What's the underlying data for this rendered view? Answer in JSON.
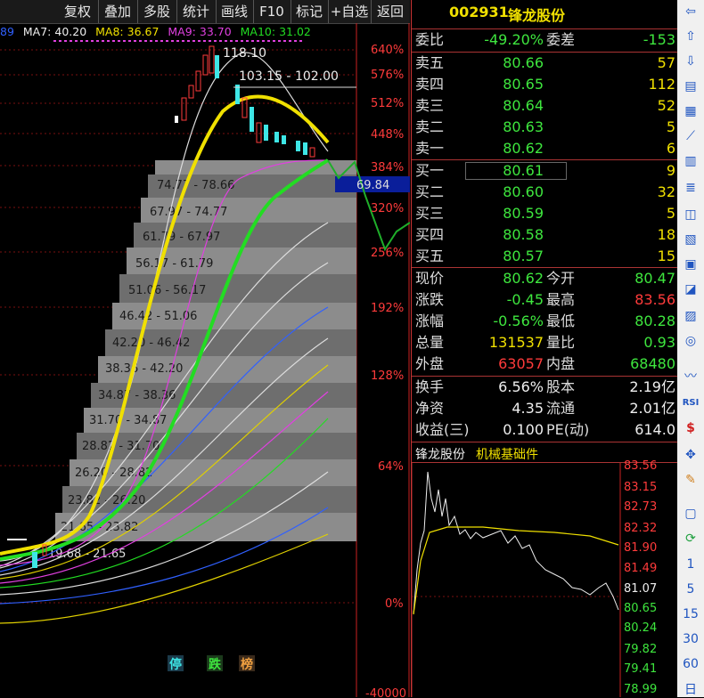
{
  "toolbar": {
    "buttons": [
      "复权",
      "叠加",
      "多股",
      "统计",
      "画线",
      "F10",
      "标记",
      "+自选",
      "返回"
    ]
  },
  "ma_line": {
    "prefix": "89",
    "ma7": "MA7: 40.20",
    "ma8": "MA8: 36.67",
    "ma9": "MA9: 33.70",
    "ma10": "MA10: 31.02"
  },
  "price_annotations": {
    "high": "118.10",
    "range": "103.15 - 102.00",
    "current_box": "69.84"
  },
  "chip_labels": [
    "74.77 - 78.66",
    "67.97 - 74.77",
    "61.79 - 67.97",
    "56.17 - 61.79",
    "51.06 - 56.17",
    "46.42 - 51.06",
    "42.20 - 46.42",
    "38.36 - 42.20",
    "34.87 - 38.36",
    "31.70 - 34.87",
    "28.82 - 31.70",
    "26.20 - 28.82",
    "23.82 - 26.20",
    "21.65 - 23.82",
    "19.68 - 21.65"
  ],
  "percent_axis": [
    "640%",
    "576%",
    "512%",
    "448%",
    "384%",
    "320%",
    "256%",
    "192%",
    "128%",
    "64%",
    "0%",
    "-40000"
  ],
  "bottom_tags": [
    "停",
    "跌",
    "榜"
  ],
  "stock": {
    "code": "002931",
    "name": "锋龙股份"
  },
  "quote": {
    "weibi_label": "委比",
    "weibi": "-49.20%",
    "weicha_label": "委差",
    "weicha": "-153",
    "asks": [
      {
        "label": "卖五",
        "price": "80.66",
        "vol": "57"
      },
      {
        "label": "卖四",
        "price": "80.65",
        "vol": "112"
      },
      {
        "label": "卖三",
        "price": "80.64",
        "vol": "52"
      },
      {
        "label": "卖二",
        "price": "80.63",
        "vol": "5"
      },
      {
        "label": "卖一",
        "price": "80.62",
        "vol": "6"
      }
    ],
    "bids": [
      {
        "label": "买一",
        "price": "80.61",
        "vol": "9"
      },
      {
        "label": "买二",
        "price": "80.60",
        "vol": "32"
      },
      {
        "label": "买三",
        "price": "80.59",
        "vol": "5"
      },
      {
        "label": "买四",
        "price": "80.58",
        "vol": "18"
      },
      {
        "label": "买五",
        "price": "80.57",
        "vol": "15"
      }
    ],
    "stats": [
      {
        "l": "现价",
        "v": "80.62",
        "l2": "今开",
        "v2": "80.47"
      },
      {
        "l": "涨跌",
        "v": "-0.45",
        "l2": "最高",
        "v2": "83.56"
      },
      {
        "l": "涨幅",
        "v": "-0.56%",
        "l2": "最低",
        "v2": "80.28"
      },
      {
        "l": "总量",
        "v": "131537",
        "l2": "量比",
        "v2": "0.93"
      },
      {
        "l": "外盘",
        "v": "63057",
        "l2": "内盘",
        "v2": "68480"
      }
    ],
    "fund": [
      {
        "l": "换手",
        "v": "6.56%",
        "l2": "股本",
        "v2": "2.19亿"
      },
      {
        "l": "净资",
        "v": "4.35",
        "l2": "流通",
        "v2": "2.01亿"
      },
      {
        "l": "收益(三)",
        "v": "0.100",
        "l2": "PE(动)",
        "v2": "614.0"
      }
    ]
  },
  "mini_chart": {
    "name": "锋龙股份",
    "sector": "机械基础件",
    "axis": [
      "83.56",
      "83.15",
      "82.73",
      "82.32",
      "81.90",
      "81.49",
      "81.07",
      "80.65",
      "80.24",
      "79.82",
      "79.41",
      "78.99"
    ]
  },
  "sidebar_numbers": [
    "1",
    "5",
    "15",
    "30",
    "60",
    "日"
  ],
  "sidebar_text": {
    "rsi": "RSI"
  },
  "colors": {
    "up": "#ff3b3b",
    "down": "#3ee63e",
    "ma_yellow": "#f0e000",
    "ma_green": "#22dd22",
    "accent_blue": "#2055c0"
  }
}
